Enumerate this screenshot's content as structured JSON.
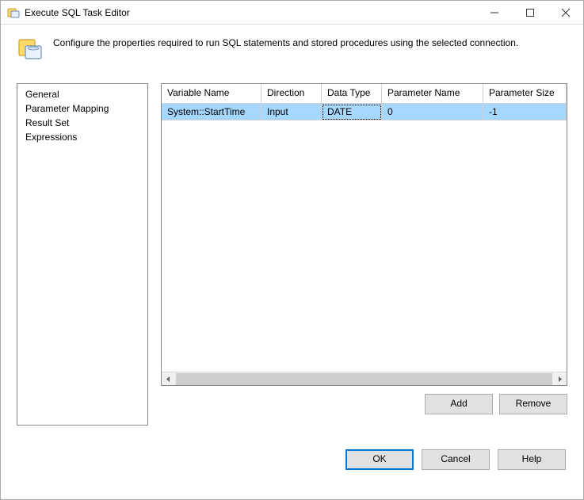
{
  "window": {
    "title": "Execute SQL Task Editor"
  },
  "header": {
    "description": "Configure the properties required to run SQL statements and stored procedures using the selected connection."
  },
  "sidebar": {
    "items": [
      {
        "label": "General"
      },
      {
        "label": "Parameter Mapping"
      },
      {
        "label": "Result Set"
      },
      {
        "label": "Expressions"
      }
    ],
    "selected_index": 1
  },
  "grid": {
    "columns": [
      {
        "label": "Variable Name"
      },
      {
        "label": "Direction"
      },
      {
        "label": "Data Type"
      },
      {
        "label": "Parameter Name"
      },
      {
        "label": "Parameter Size"
      }
    ],
    "rows": [
      {
        "variable_name": "System::StartTime",
        "direction": "Input",
        "data_type": "DATE",
        "parameter_name": "0",
        "parameter_size": "-1"
      }
    ],
    "selected_row": 0,
    "focused_col": 2
  },
  "buttons": {
    "add": "Add",
    "remove": "Remove",
    "ok": "OK",
    "cancel": "Cancel",
    "help": "Help"
  }
}
